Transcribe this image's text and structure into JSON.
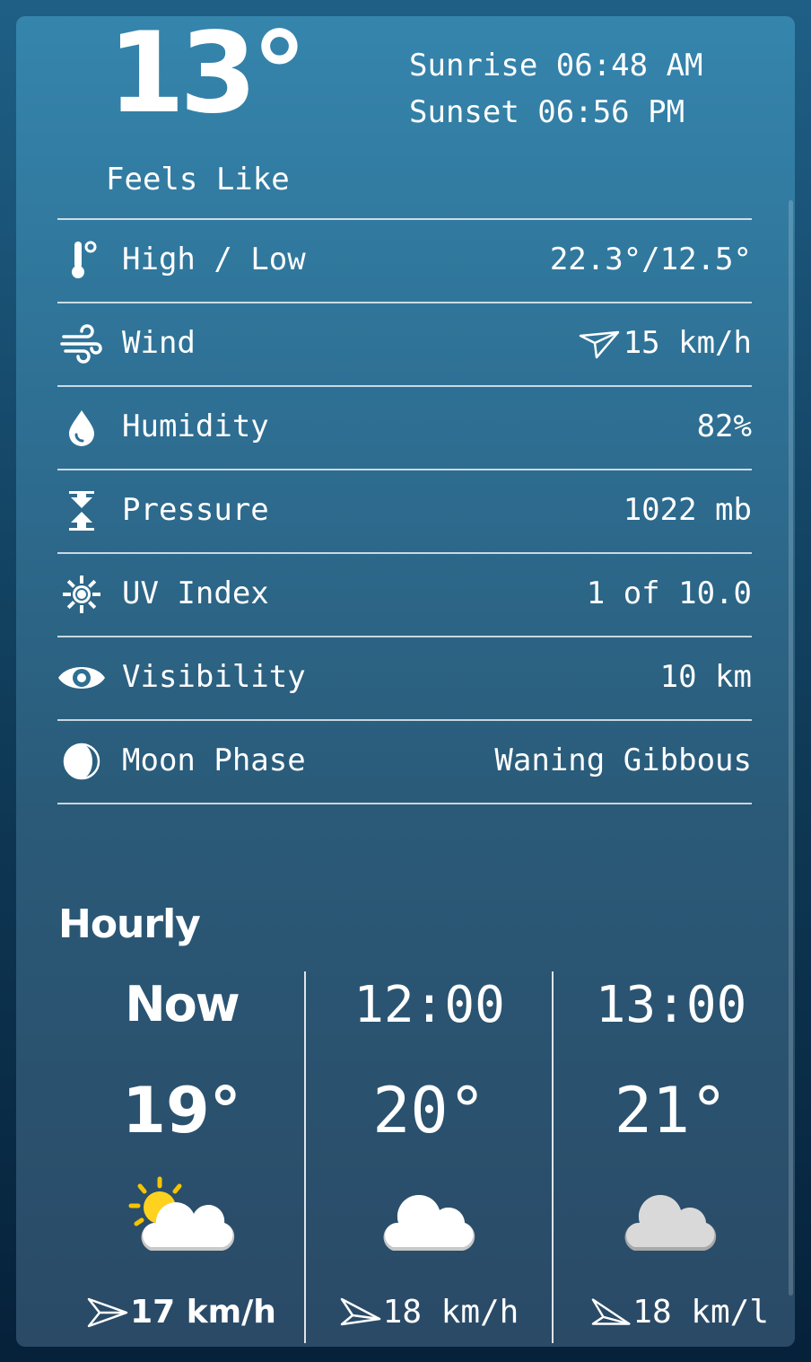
{
  "current": {
    "temperature": "13°",
    "sunrise": "Sunrise 06:48 AM",
    "sunset": "Sunset 06:56 PM",
    "feels_like_label": "Feels Like"
  },
  "details": [
    {
      "icon": "thermometer-icon",
      "label": "High / Low",
      "value": "22.3°/12.5°"
    },
    {
      "icon": "wind-icon",
      "label": "Wind",
      "value": "15 km/h"
    },
    {
      "icon": "humidity-drop-icon",
      "label": "Humidity",
      "value": "82%"
    },
    {
      "icon": "pressure-icon",
      "label": "Pressure",
      "value": "1022 mb"
    },
    {
      "icon": "uv-sun-icon",
      "label": "UV Index",
      "value": "1 of 10.0"
    },
    {
      "icon": "eye-icon",
      "label": "Visibility",
      "value": "10 km"
    },
    {
      "icon": "moon-phase-icon",
      "label": "Moon Phase",
      "value": "Waning Gibbous"
    }
  ],
  "hourly": {
    "title": "Hourly",
    "items": [
      {
        "time": "Now",
        "temp": "19°",
        "condition_icon": "partly-sunny-icon",
        "wind": "17 km/h"
      },
      {
        "time": "12:00",
        "temp": "20°",
        "condition_icon": "cloud-icon",
        "wind": "18 km/h"
      },
      {
        "time": "13:00",
        "temp": "21°",
        "condition_icon": "cloud-icon",
        "wind": "18 km/l"
      }
    ]
  },
  "colors": {
    "background_top": "#1f5f86",
    "card_top": "#3585ad",
    "card_bottom": "#2a4a66",
    "text": "#ffffff"
  }
}
